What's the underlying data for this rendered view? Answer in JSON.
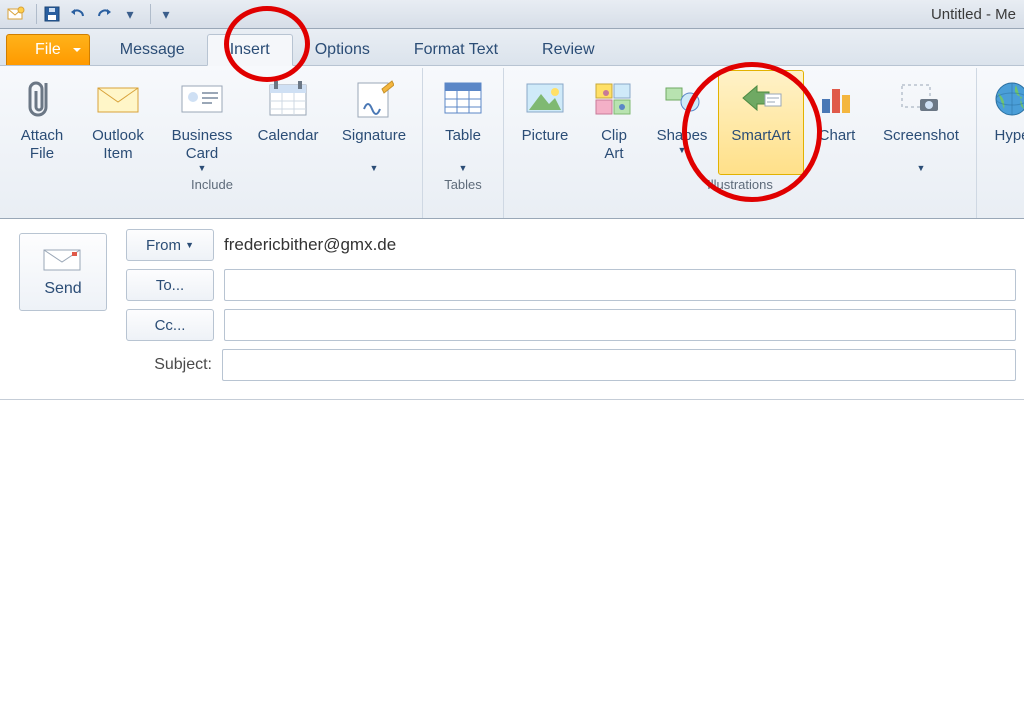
{
  "window": {
    "title": "Untitled - Me"
  },
  "qat": {
    "icons": [
      "mail-new-icon",
      "save-icon",
      "undo-icon",
      "redo-icon",
      "more-icon",
      "customize-icon"
    ]
  },
  "tabs": {
    "file": "File",
    "items": [
      {
        "id": "message",
        "label": "Message"
      },
      {
        "id": "insert",
        "label": "Insert",
        "active": true
      },
      {
        "id": "options",
        "label": "Options"
      },
      {
        "id": "formattext",
        "label": "Format Text"
      },
      {
        "id": "review",
        "label": "Review"
      }
    ]
  },
  "ribbon": {
    "groups": [
      {
        "id": "include",
        "label": "Include",
        "buttons": [
          {
            "id": "attach-file",
            "label": "Attach\nFile",
            "icon": "paperclip-icon"
          },
          {
            "id": "outlook-item",
            "label": "Outlook\nItem",
            "icon": "envelope-icon"
          },
          {
            "id": "business-card",
            "label": "Business\nCard",
            "icon": "businesscard-icon",
            "dropdown": true
          },
          {
            "id": "calendar",
            "label": "Calendar",
            "icon": "calendar-icon"
          },
          {
            "id": "signature",
            "label": "Signature",
            "icon": "signature-icon",
            "dropdown": true
          }
        ]
      },
      {
        "id": "tables",
        "label": "Tables",
        "buttons": [
          {
            "id": "table",
            "label": "Table",
            "icon": "table-icon",
            "dropdown": true
          }
        ]
      },
      {
        "id": "illustrations",
        "label": "Illustrations",
        "buttons": [
          {
            "id": "picture",
            "label": "Picture",
            "icon": "picture-icon"
          },
          {
            "id": "clip-art",
            "label": "Clip\nArt",
            "icon": "clipart-icon"
          },
          {
            "id": "shapes",
            "label": "Shapes",
            "icon": "shapes-icon",
            "dropdown": true
          },
          {
            "id": "smartart",
            "label": "SmartArt",
            "icon": "smartart-icon",
            "selected": true
          },
          {
            "id": "chart",
            "label": "Chart",
            "icon": "chart-icon"
          },
          {
            "id": "screenshot",
            "label": "Screenshot",
            "icon": "screenshot-icon",
            "dropdown": true
          }
        ]
      },
      {
        "id": "links",
        "label": "",
        "buttons": [
          {
            "id": "hyperlink",
            "label": "Hype",
            "icon": "globe-icon"
          }
        ]
      }
    ]
  },
  "compose": {
    "send": "Send",
    "from_button": "From",
    "from_value": "fredericbither@gmx.de",
    "to_button": "To...",
    "cc_button": "Cc...",
    "subject_label": "Subject:",
    "to_value": "",
    "cc_value": "",
    "subject_value": ""
  }
}
